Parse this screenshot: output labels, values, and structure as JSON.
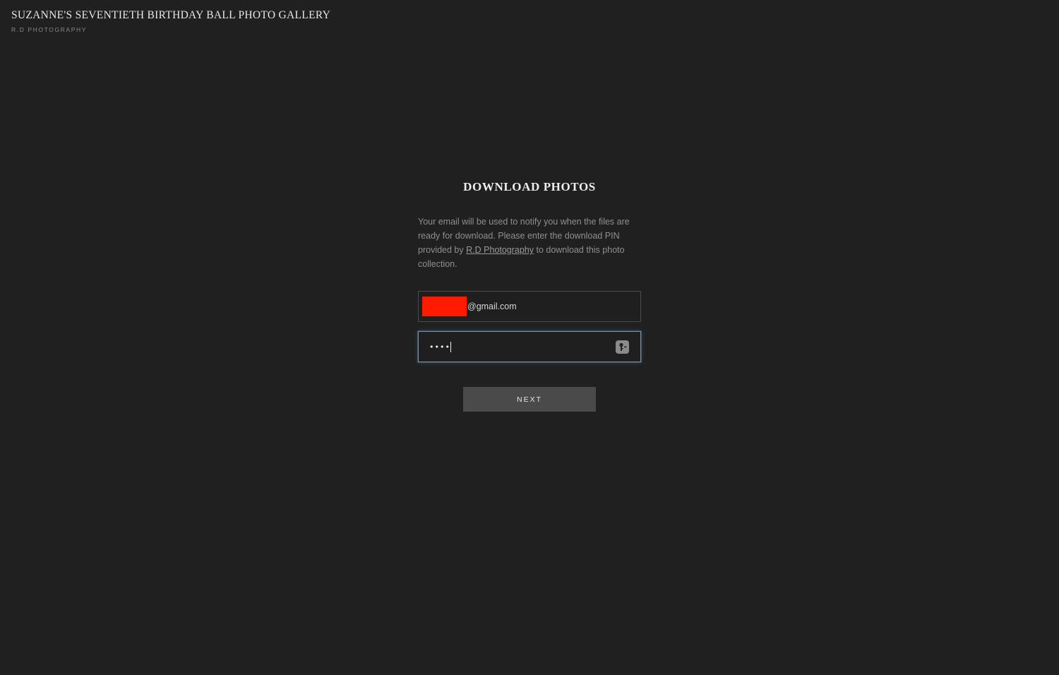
{
  "header": {
    "title": "SUZANNE'S SEVENTIETH BIRTHDAY BALL PHOTO GALLERY",
    "subtitle": "R.D PHOTOGRAPHY"
  },
  "download": {
    "title": "DOWNLOAD PHOTOS",
    "description_part1": "Your email will be used to notify you when the files are ready for download. Please enter the download PIN provided by ",
    "description_link": "R.D Photography",
    "description_part2": " to download this photo collection.",
    "email_value_visible": "@gmail.com",
    "pin_value_masked": "••••",
    "next_label": "NEXT"
  },
  "colors": {
    "background": "#202020",
    "redaction": "#ff1a00",
    "button": "#4a4a4a",
    "focus_border": "#7c8fa0"
  },
  "icons": {
    "password_manager": "password-key-icon"
  }
}
